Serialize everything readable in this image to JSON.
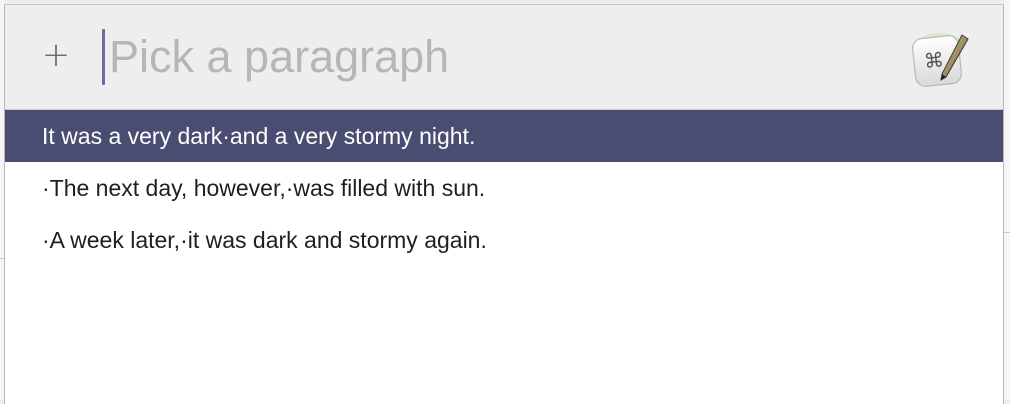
{
  "search": {
    "placeholder": "Pick a paragraph",
    "value": ""
  },
  "toolbar": {
    "add_label": "+"
  },
  "app_icon": {
    "glyph": "⌘",
    "name": "keyboard-maestro-icon"
  },
  "results": [
    {
      "label": "It was a very dark·and a very stormy night.",
      "selected": true
    },
    {
      "label": "·The next day, however,·was filled with sun.",
      "selected": false
    },
    {
      "label": "·A week later,·it was dark and stormy again.",
      "selected": false
    }
  ],
  "colors": {
    "selection": "#4a4d72",
    "caret": "#6f6aa6",
    "placeholder": "#b6b6b6"
  }
}
